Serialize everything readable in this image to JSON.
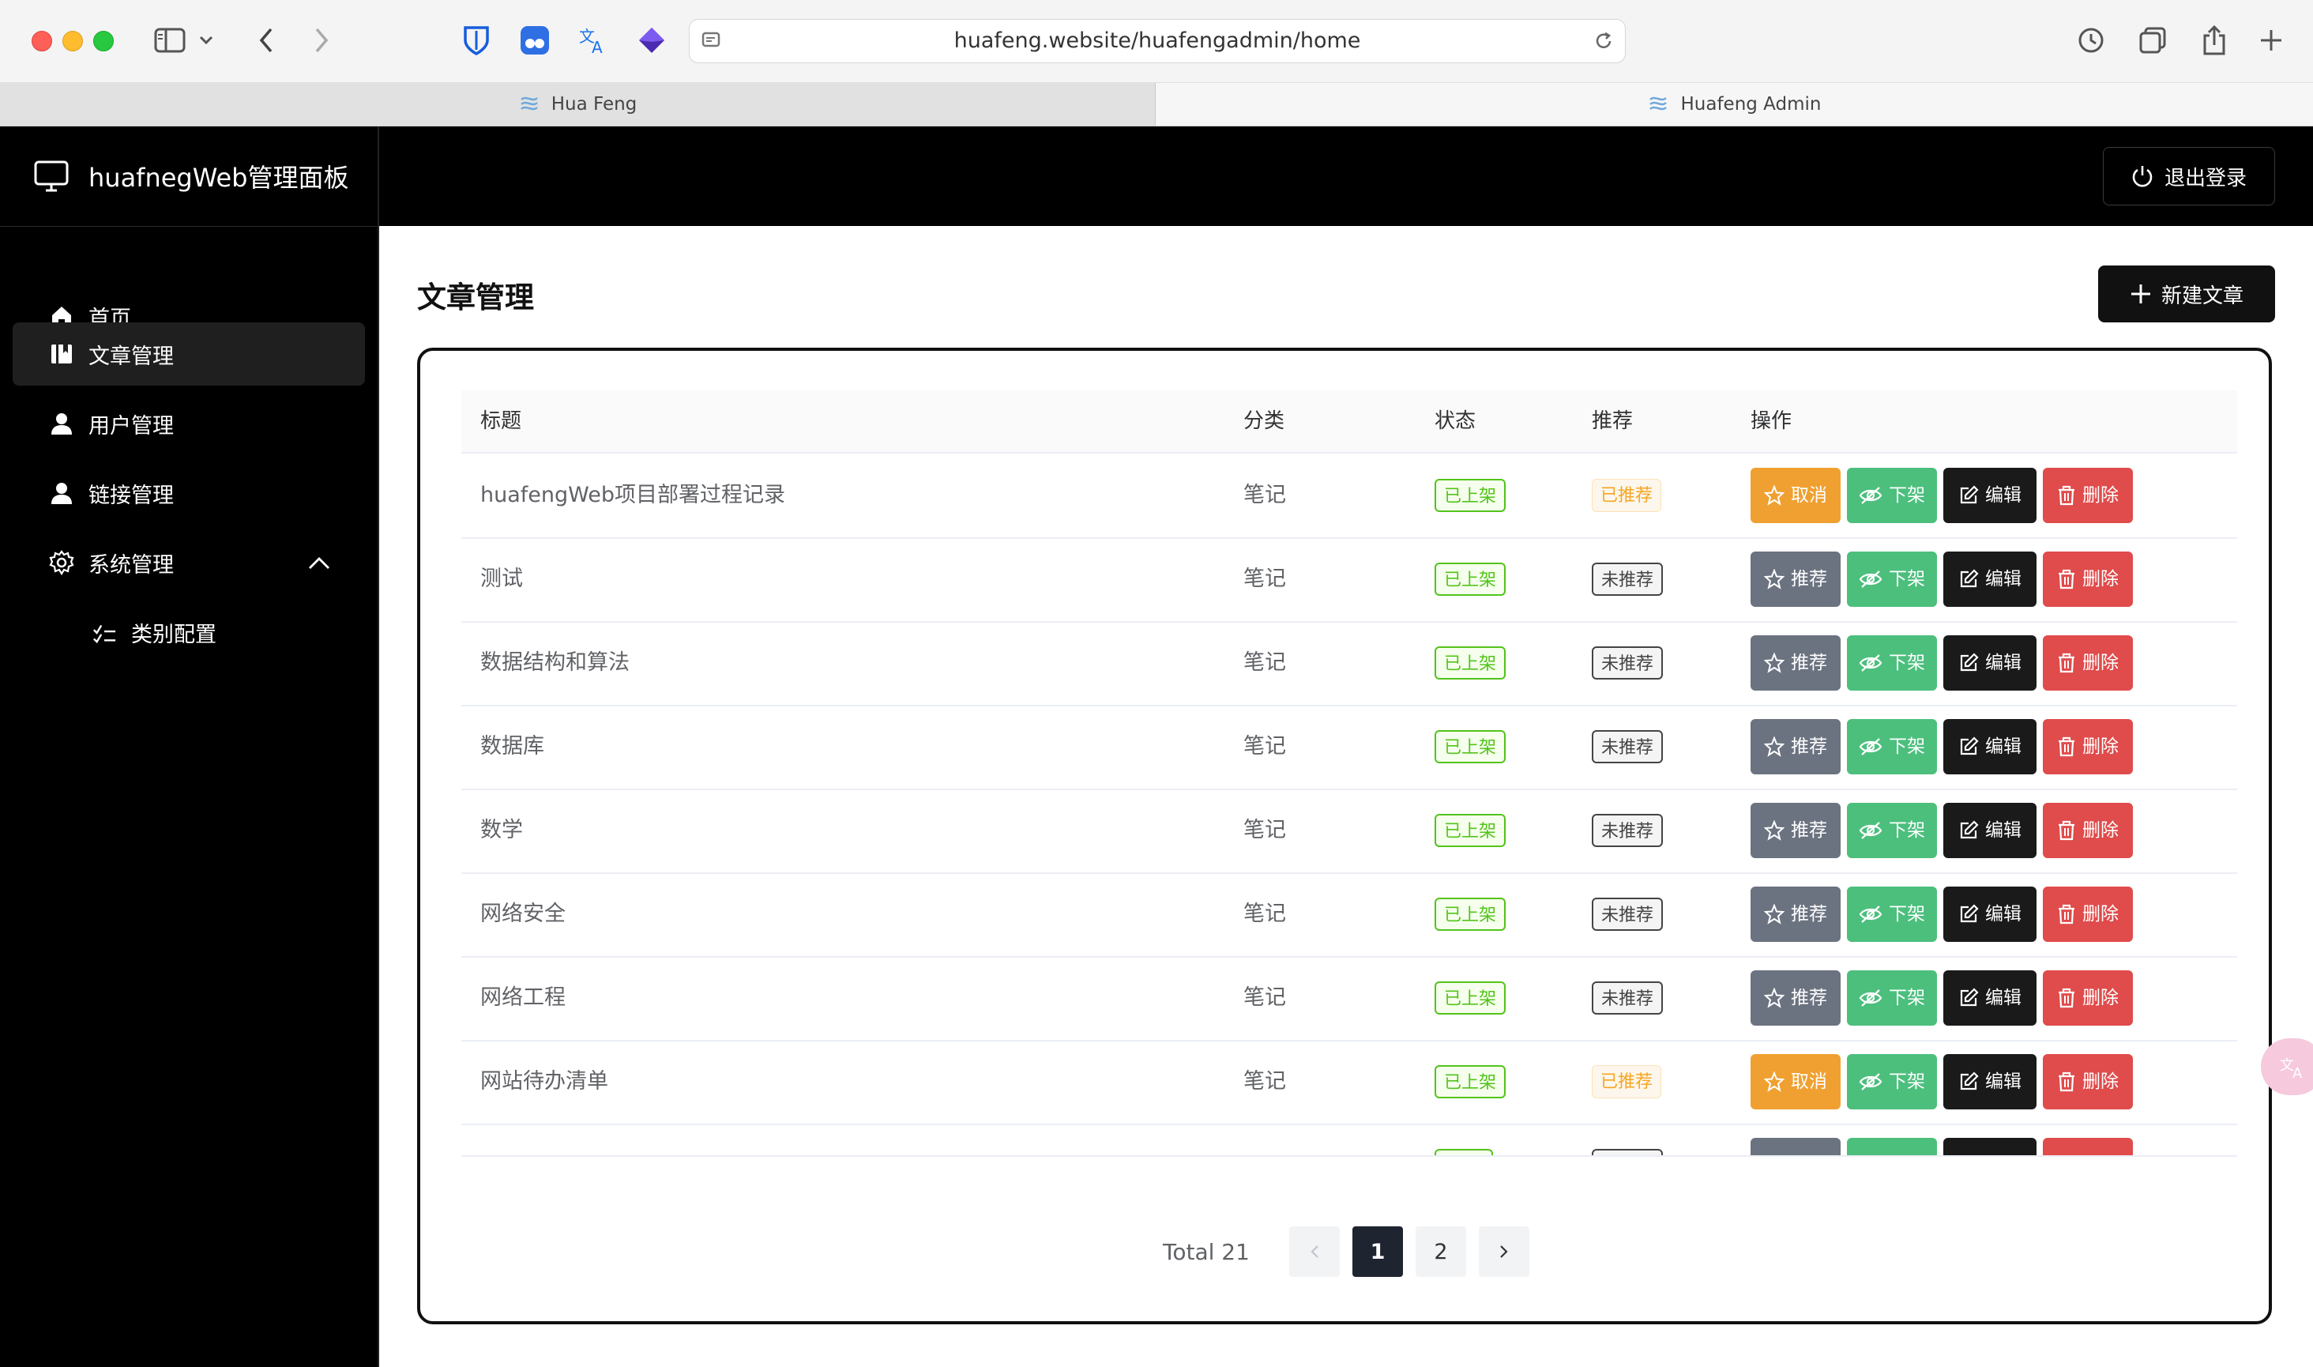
{
  "browser": {
    "url": "huafeng.website/huafengadmin/home",
    "tabs": [
      {
        "label": "Hua Feng"
      },
      {
        "label": "Huafeng Admin"
      }
    ]
  },
  "sidebar": {
    "brand": "huafnegWeb管理面板",
    "items": [
      {
        "label": "首页",
        "icon": "home-icon"
      },
      {
        "label": "文章管理",
        "icon": "book-icon",
        "active": true
      },
      {
        "label": "用户管理",
        "icon": "user-icon"
      },
      {
        "label": "链接管理",
        "icon": "user-icon"
      },
      {
        "label": "系统管理",
        "icon": "gear-icon",
        "expanded": true
      },
      {
        "label": "类别配置",
        "icon": "checklist-icon",
        "sub": true
      }
    ]
  },
  "header": {
    "logout_label": "退出登录"
  },
  "main": {
    "title": "文章管理",
    "new_button": "新建文章"
  },
  "table": {
    "columns": [
      "标题",
      "分类",
      "状态",
      "推荐",
      "操作"
    ],
    "rows": [
      {
        "title": "huafengWeb项目部署过程记录",
        "category": "笔记",
        "status": "已上架",
        "recommend": "已推荐",
        "rec_action": "取消"
      },
      {
        "title": "测试",
        "category": "笔记",
        "status": "已上架",
        "recommend": "未推荐",
        "rec_action": "推荐"
      },
      {
        "title": "数据结构和算法",
        "category": "笔记",
        "status": "已上架",
        "recommend": "未推荐",
        "rec_action": "推荐"
      },
      {
        "title": "数据库",
        "category": "笔记",
        "status": "已上架",
        "recommend": "未推荐",
        "rec_action": "推荐"
      },
      {
        "title": "数学",
        "category": "笔记",
        "status": "已上架",
        "recommend": "未推荐",
        "rec_action": "推荐"
      },
      {
        "title": "网络安全",
        "category": "笔记",
        "status": "已上架",
        "recommend": "未推荐",
        "rec_action": "推荐"
      },
      {
        "title": "网络工程",
        "category": "笔记",
        "status": "已上架",
        "recommend": "未推荐",
        "rec_action": "推荐"
      },
      {
        "title": "网站待办清单",
        "category": "笔记",
        "status": "已上架",
        "recommend": "已推荐",
        "rec_action": "取消"
      }
    ],
    "actions": {
      "unlist": "下架",
      "edit": "编辑",
      "delete": "删除"
    }
  },
  "pagination": {
    "total": "Total 21",
    "pages": [
      "1",
      "2"
    ],
    "current": "1"
  },
  "colors": {
    "accent": "#111111",
    "listed_tag": "#52c41a",
    "recommended_tag": "#f5a623",
    "cancel_button": "#f0a030",
    "recommend_button": "#6b7280",
    "unlist_button": "#4cbf7d",
    "edit_button": "#1a1a1a",
    "delete_button": "#e04b4b"
  }
}
